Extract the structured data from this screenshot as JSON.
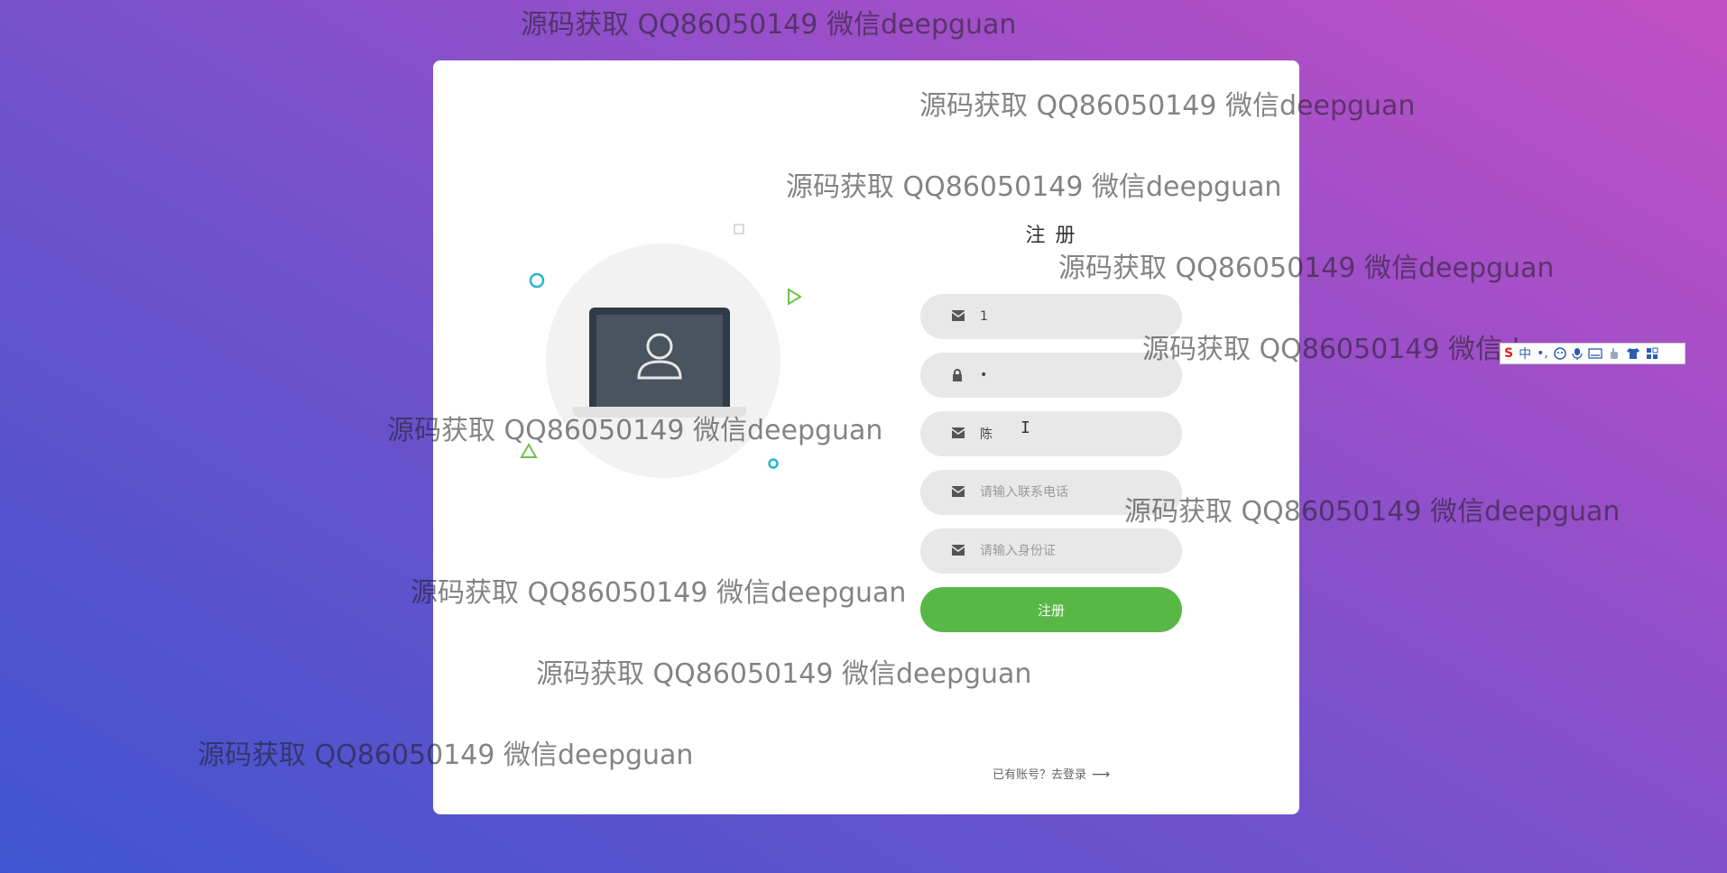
{
  "register_form": {
    "title": "注 册",
    "fields": [
      {
        "icon": "envelope-icon",
        "value": "1",
        "placeholder": ""
      },
      {
        "icon": "lock-icon",
        "value": "•",
        "placeholder": ""
      },
      {
        "icon": "envelope-icon",
        "value": "陈",
        "placeholder": ""
      },
      {
        "icon": "envelope-icon",
        "value": "",
        "placeholder": "请输入联系电话"
      },
      {
        "icon": "envelope-icon",
        "value": "",
        "placeholder": "请输入身份证"
      }
    ],
    "submit_label": "注册",
    "login_link": {
      "text": "已有账号？去登录",
      "arrow": "⟶"
    }
  },
  "watermark_text": "源码获取 QQ86050149 微信deepguan",
  "ime_toolbar": {
    "logo": "S",
    "mode": "中",
    "punct": "•,"
  },
  "colors": {
    "button": "#57b846",
    "input_bg": "#e8e8e8",
    "background_from": "#3f55cf",
    "background_to": "#c24fc4"
  }
}
